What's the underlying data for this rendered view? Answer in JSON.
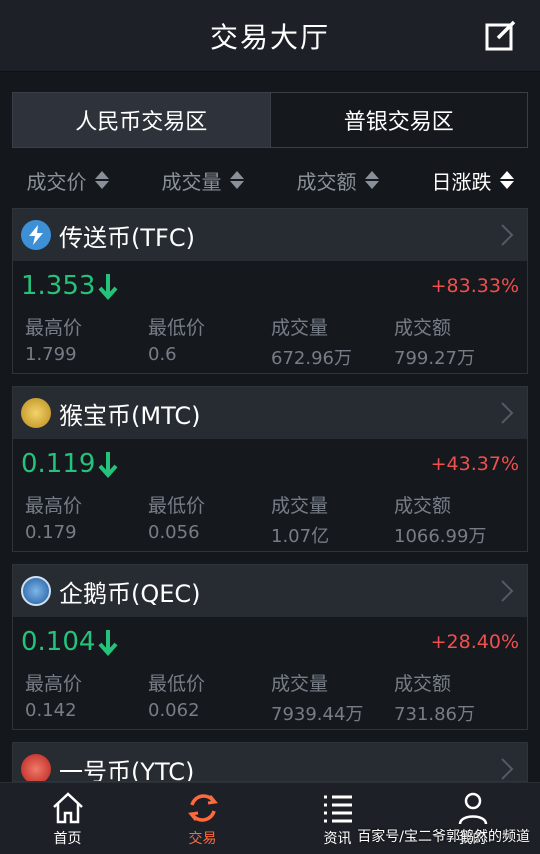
{
  "header": {
    "title": "交易大厅"
  },
  "tabs": [
    {
      "label": "人民币交易区",
      "active": true
    },
    {
      "label": "普银交易区",
      "active": false
    }
  ],
  "sort": [
    {
      "label": "成交价"
    },
    {
      "label": "成交量"
    },
    {
      "label": "成交额"
    },
    {
      "label": "日涨跌"
    }
  ],
  "coins": [
    {
      "name": "传送币(TFC)",
      "icon": "lightning-coin-icon",
      "icon_color": "#3d8fd6",
      "price": "1.353",
      "change": "+83.33%",
      "stats": [
        {
          "label": "最高价",
          "value": "1.799"
        },
        {
          "label": "最低价",
          "value": "0.6"
        },
        {
          "label": "成交量",
          "value": "672.96万"
        },
        {
          "label": "成交额",
          "value": "799.27万"
        }
      ]
    },
    {
      "name": "猴宝币(MTC)",
      "icon": "monkey-coin-icon",
      "icon_color": "#d4a62a",
      "price": "0.119",
      "change": "+43.37%",
      "stats": [
        {
          "label": "最高价",
          "value": "0.179"
        },
        {
          "label": "最低价",
          "value": "0.056"
        },
        {
          "label": "成交量",
          "value": "1.07亿"
        },
        {
          "label": "成交额",
          "value": "1066.99万"
        }
      ]
    },
    {
      "name": "企鹅币(QEC)",
      "icon": "penguin-coin-icon",
      "icon_color": "#2f6fb8",
      "price": "0.104",
      "change": "+28.40%",
      "stats": [
        {
          "label": "最高价",
          "value": "0.142"
        },
        {
          "label": "最低价",
          "value": "0.062"
        },
        {
          "label": "成交量",
          "value": "7939.44万"
        },
        {
          "label": "成交额",
          "value": "731.86万"
        }
      ]
    },
    {
      "name": "一号币(YTC)",
      "icon": "ytc-coin-icon",
      "icon_color": "#d63a3a"
    }
  ],
  "nav": [
    {
      "label": "首页",
      "icon": "home-icon"
    },
    {
      "label": "交易",
      "icon": "refresh-icon",
      "active": true
    },
    {
      "label": "资讯",
      "icon": "list-icon"
    },
    {
      "label": "我的",
      "icon": "user-icon"
    }
  ],
  "watermark": "百家号/宝二爷郭鹤然的频道",
  "colors": {
    "up": "#f0504d",
    "price": "#24c27a",
    "nav_active": "#ff6a3d"
  }
}
